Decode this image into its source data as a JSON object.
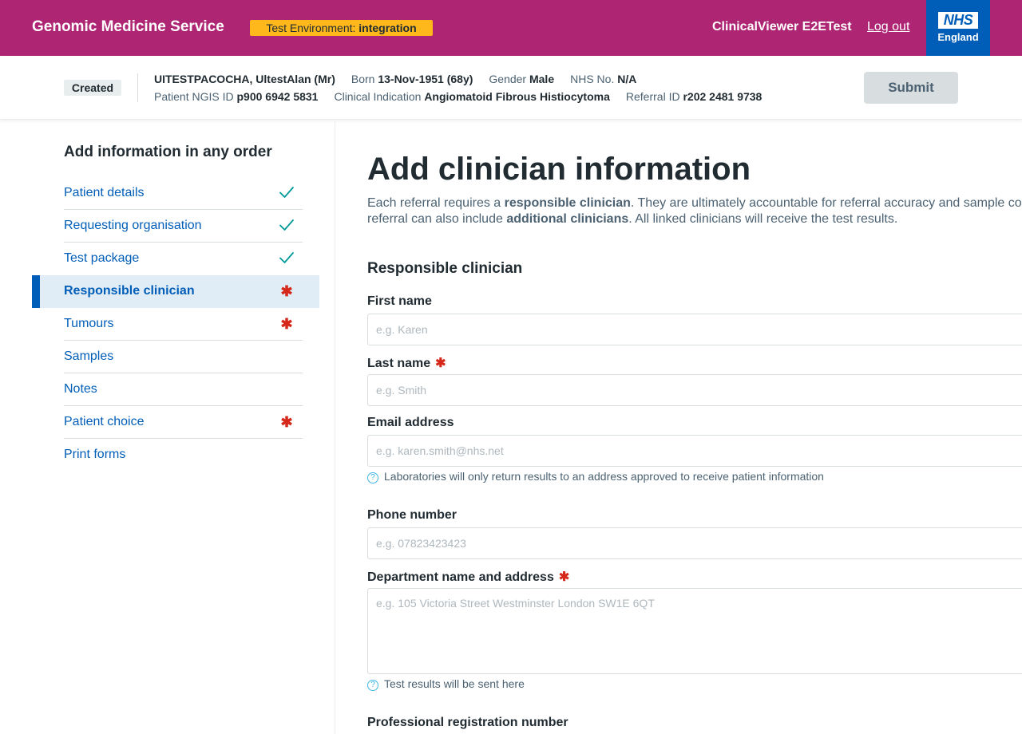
{
  "header": {
    "service_name": "Genomic Medicine Service",
    "env_prefix": "Test Environment: ",
    "env_name": "integration",
    "user_name": "ClinicalViewer E2ETest",
    "logout_label": "Log out",
    "logo_text": "NHS",
    "logo_subtext": "England"
  },
  "banner": {
    "status": "Created",
    "patient_name": "UITESTPACOCHA, UltestAlan (Mr)",
    "born_label": "Born",
    "born_value": "13-Nov-1951 (68y)",
    "gender_label": "Gender",
    "gender_value": "Male",
    "nhs_label": "NHS No.",
    "nhs_value": "N/A",
    "ngis_label": "Patient NGIS ID",
    "ngis_value": "p900 6942 5831",
    "indication_label": "Clinical Indication",
    "indication_value": "Angiomatoid Fibrous Histiocytoma",
    "referral_label": "Referral ID",
    "referral_value": "r202 2481 9738",
    "submit_label": "Submit"
  },
  "sidebar": {
    "title": "Add information in any order",
    "items": [
      {
        "label": "Patient details",
        "mark": "check-icon"
      },
      {
        "label": "Requesting organisation",
        "mark": "check-icon"
      },
      {
        "label": "Test package",
        "mark": "check-icon"
      },
      {
        "label": "Responsible clinician",
        "mark": "required-icon",
        "active": true
      },
      {
        "label": "Tumours",
        "mark": "required-icon"
      },
      {
        "label": "Samples",
        "mark": ""
      },
      {
        "label": "Notes",
        "mark": ""
      },
      {
        "label": "Patient choice",
        "mark": "required-icon"
      },
      {
        "label": "Print forms",
        "mark": ""
      }
    ],
    "check_glyph": "✓",
    "required_glyph": "✱"
  },
  "main": {
    "title": "Add clinician information",
    "intro_1a": "Each referral requires a ",
    "intro_1b": "responsible clinician",
    "intro_1c": ". They are ultimately accountable for referral accuracy and sample co",
    "intro_2a": "referral can also include ",
    "intro_2b": "additional clinicians",
    "intro_2c": ". All linked clinicians will receive the test results.",
    "section_title": "Responsible clinician",
    "fields": {
      "first_name": {
        "label": "First name",
        "placeholder": "e.g. Karen",
        "value": ""
      },
      "last_name": {
        "label": "Last name",
        "placeholder": "e.g. Smith",
        "value": ""
      },
      "email": {
        "label": "Email address",
        "placeholder": "e.g. karen.smith@nhs.net",
        "value": "",
        "hint": "Laboratories will only return results to an address approved to receive patient information"
      },
      "phone": {
        "label": "Phone number",
        "placeholder": "e.g. 07823423423",
        "value": ""
      },
      "department": {
        "label": "Department name and address",
        "placeholder": "e.g. 105 Victoria Street Westminster London SW1E 6QT",
        "value": "",
        "hint": "Test results will be sent here"
      },
      "registration": {
        "label": "Professional registration number"
      }
    },
    "required_glyph": "✱",
    "help_glyph": "?"
  },
  "colors": {
    "header_bg": "#ae2573",
    "env_badge": "#ffb81c",
    "nhs_blue": "#005eb8",
    "link": "#005eb8",
    "required": "#d5281b",
    "check": "#009999",
    "active_bg": "#e0ecf6"
  }
}
